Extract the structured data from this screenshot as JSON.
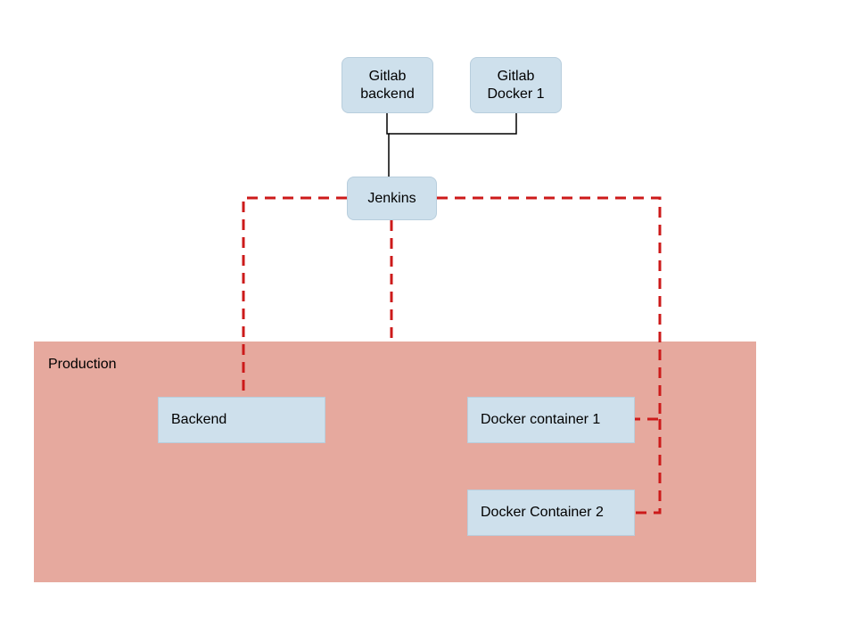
{
  "nodes": {
    "gitlab_backend": "Gitlab backend",
    "gitlab_docker1": "Gitlab Docker 1",
    "jenkins": "Jenkins",
    "backend": "Backend",
    "docker1": "Docker container 1",
    "docker2": "Docker Container 2"
  },
  "container": {
    "production_label": "Production"
  },
  "colors": {
    "node_fill": "#cee0ec",
    "container_fill": "#e6a99e",
    "dashed_stroke": "#cc1a1a",
    "solid_stroke": "#000000"
  }
}
